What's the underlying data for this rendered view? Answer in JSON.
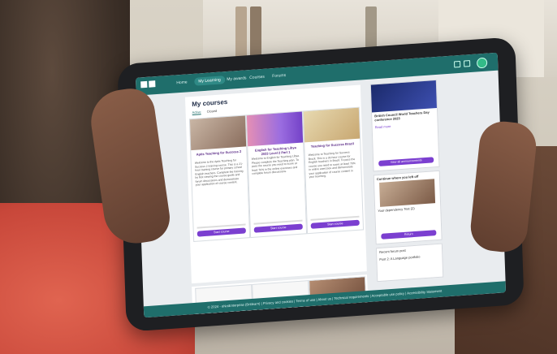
{
  "topbar": {
    "nav": [
      "Home",
      "My Learning",
      "My awards",
      "Courses",
      "Forums"
    ]
  },
  "main": {
    "title": "My courses",
    "tabs": [
      "Active",
      "Closed"
    ],
    "cards": [
      {
        "title": "Aptis Teaching for Success 2",
        "body": "Welcome to the Aptis Teaching for Success 2 training course. This is a 21-hour training course for primary school English teachers. Complete the training by first viewing the course guide and forum discussions and demonstrate your application of course content.",
        "progress": "Progress: 10%",
        "button": "Start course"
      },
      {
        "title": "English for Teaching Libya 2023 Level 2 Part 1",
        "body": "Welcome to English for Teaching Libya. Please complete the Teaching plan. To pass the course you need to score at least 70% in the online exercises and complete forum discussions.",
        "progress": "Progress: 0%",
        "button": "Start course"
      },
      {
        "title": "Teaching for Success Brazil",
        "body": "Welcome to Teaching for Success Brazil. This is a 30-hour course for English teachers in Brazil. To pass the course you need to score at least 70% in online exercises and demonstrate your application of course content in your teaching.",
        "progress": "Progress: 0%",
        "button": "Start course"
      }
    ]
  },
  "side": {
    "news_title": "British Council World Teachers Day conference 2023",
    "news_read_more": "Read more",
    "all_announcements": "View all announcements",
    "continue_title": "Continue where you left off",
    "continue_item": "Your dependency Test (2)",
    "return_label": "Return",
    "recent_title": "Recent forum post",
    "recent_item": "Post 2: A Language portfolio"
  },
  "footer": {
    "text": "© 2024 - eNotEnterprise (Britlearn) | Privacy and cookies | Terms of use | About us | Technical requirements | Acceptable use policy | Accessibility Statement"
  },
  "colors": {
    "accent": "#1f6e6b",
    "button": "#7b3fd0"
  }
}
